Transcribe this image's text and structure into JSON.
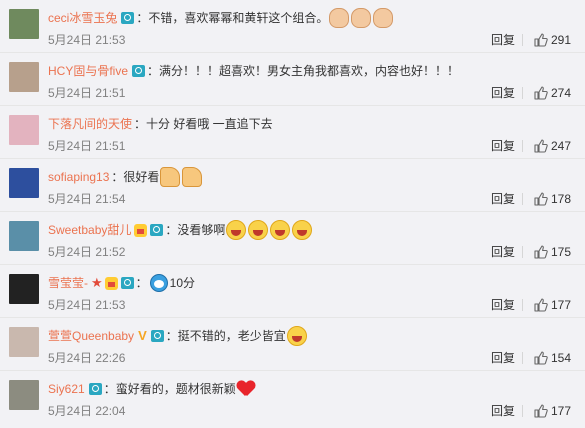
{
  "ui": {
    "reply_label": "回复"
  },
  "comments": [
    {
      "user": "ceci冰雪玉兔",
      "badges": [
        "camera"
      ],
      "text": "：不错，喜欢幂幂和黄轩这个组合。",
      "emojis": [
        "clap",
        "clap",
        "clap"
      ],
      "time": "5月24日 21:53",
      "likes": "291",
      "avatar_color": "#6f8a5e"
    },
    {
      "user": "HCY固与骨five",
      "badges": [
        "camera"
      ],
      "text": "：满分！！！超喜欢！男女主角我都喜欢，内容也好！！！",
      "emojis": [],
      "time": "5月24日 21:51",
      "likes": "274",
      "avatar_color": "#b7a08c"
    },
    {
      "user": "下落凡间的天使",
      "badges": [],
      "text": "：十分   好看哦   一直追下去",
      "emojis": [],
      "time": "5月24日 21:51",
      "likes": "247",
      "avatar_color": "#e3b3bf"
    },
    {
      "user": "sofiaping13",
      "badges": [],
      "text": "：很好看",
      "emojis": [
        "thumb",
        "thumb"
      ],
      "time": "5月24日 21:54",
      "likes": "178",
      "avatar_color": "#2d4f9e"
    },
    {
      "user": "Sweetbaby甜儿",
      "badges": [
        "crown",
        "camera"
      ],
      "text": "：没看够啊",
      "emojis": [
        "laugh",
        "laugh",
        "laugh",
        "laugh"
      ],
      "time": "5月24日 21:52",
      "likes": "175",
      "avatar_color": "#5a8fa8"
    },
    {
      "user": "雪莹莹-",
      "badges": [
        "star",
        "crown",
        "camera"
      ],
      "text": "：",
      "emojis": [
        "doraemon"
      ],
      "text_after": "10分",
      "time": "5月24日 21:53",
      "likes": "177",
      "avatar_color": "#222222"
    },
    {
      "user": "萱萱Queenbaby",
      "badges": [
        "v",
        "camera"
      ],
      "text": "：挺不错的，老少皆宜",
      "emojis": [
        "laugh"
      ],
      "time": "5月24日 22:26",
      "likes": "154",
      "avatar_color": "#c9b8ae"
    },
    {
      "user": "Siy621",
      "badges": [
        "camera"
      ],
      "text": "：蛮好看的，题材很新颖",
      "emojis": [
        "heart"
      ],
      "time": "5月24日 22:04",
      "likes": "177",
      "avatar_color": "#8c8c80"
    }
  ]
}
